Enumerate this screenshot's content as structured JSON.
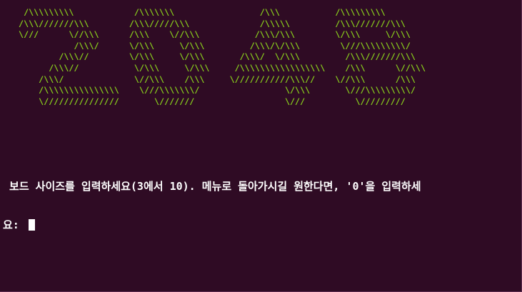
{
  "ascii_logo": {
    "lines": [
      "  /\\\\\\\\\\\\\\\\\\            /\\\\\\\\\\\\\\                 /\\\\\\           /\\\\\\\\\\\\\\\\\\",
      " /\\\\\\///////\\\\\\        /\\\\\\/////\\\\\\              /\\\\\\\\\\         /\\\\\\///////\\\\\\",
      " \\///      \\//\\\\\\      /\\\\\\    \\//\\\\\\           /\\\\\\/\\\\\\        \\/\\\\\\     \\/\\\\\\",
      "            /\\\\\\/      \\/\\\\\\     \\/\\\\\\         /\\\\\\/\\/\\\\\\        \\///\\\\\\\\\\\\\\\\\\/",
      "         /\\\\\\//        \\/\\\\\\     \\/\\\\\\       /\\\\\\/  \\/\\\\\\         /\\\\\\///////\\\\\\",
      "       /\\\\\\//           \\/\\\\\\     \\/\\\\\\     /\\\\\\\\\\\\\\\\\\\\\\\\\\\\\\\\\\    /\\\\\\      \\//\\\\\\",
      "     /\\\\\\/              \\//\\\\\\    /\\\\\\     \\///////////\\\\\\//    \\//\\\\\\      /\\\\\\",
      "     /\\\\\\\\\\\\\\\\\\\\\\\\\\\\\\    \\///\\\\\\\\\\\\\\/                 \\/\\\\\\       \\///\\\\\\\\\\\\\\\\\\/",
      "     \\///////////////       \\///////                  \\///          \\/////////"
    ]
  },
  "prompt": {
    "line1": " 보드 사이즈를 입력하세요(3에서 10). 메뉴로 돌아가시길 원한다면, '0'을 입력하세",
    "line2": "요: "
  },
  "colors": {
    "background": "#2f0b24",
    "logo": "#8ad11c",
    "text": "#ffffff"
  }
}
